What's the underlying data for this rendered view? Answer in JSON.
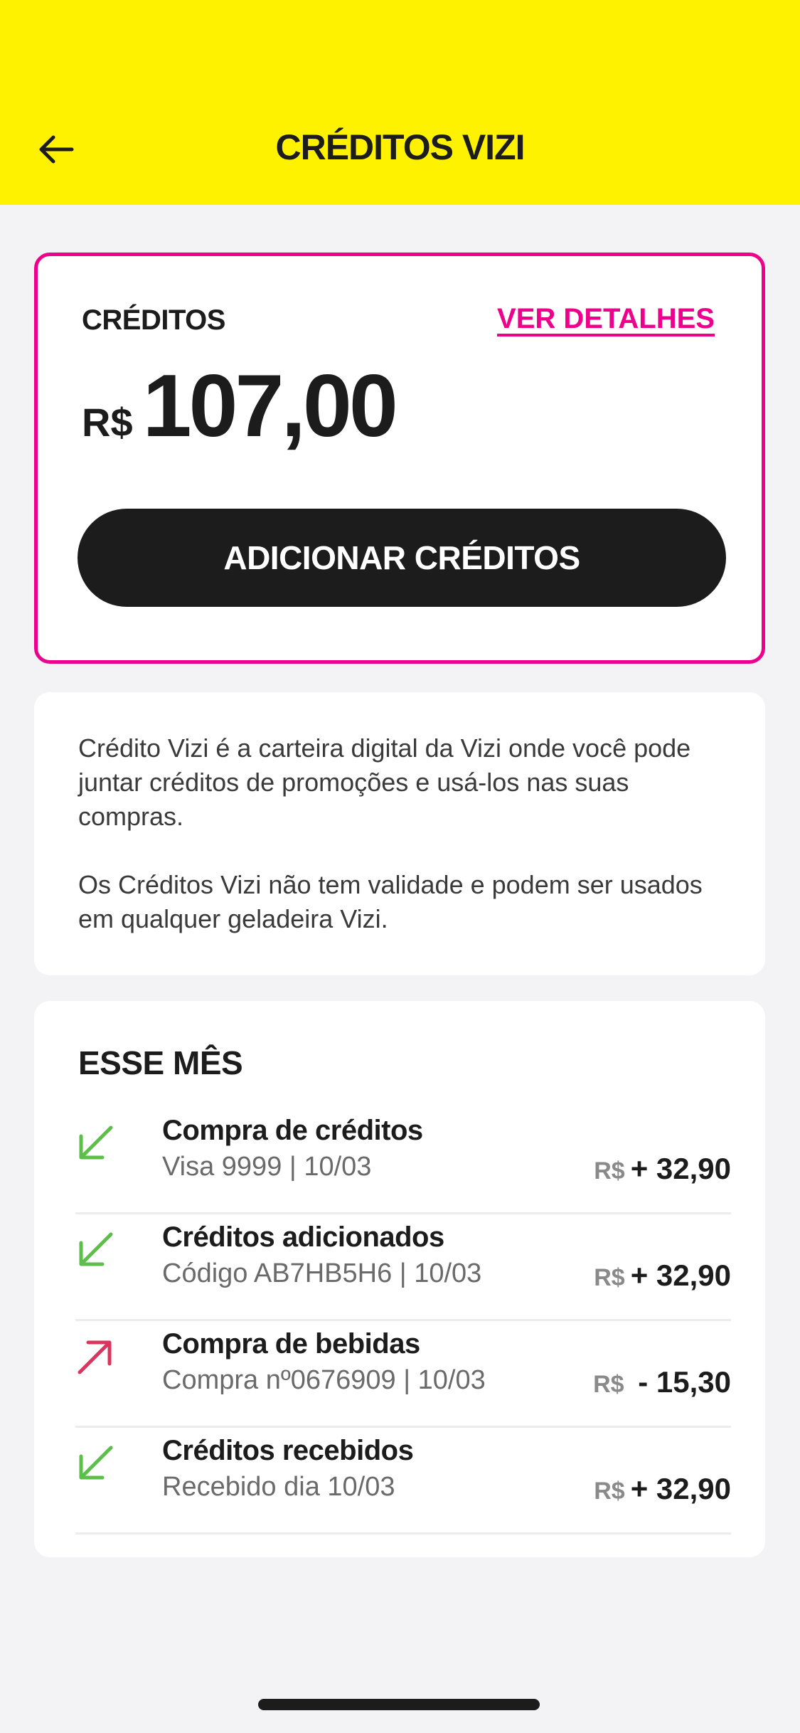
{
  "header": {
    "title": "CRÉDITOS VIZI",
    "back_icon": "arrow-left-icon"
  },
  "balance": {
    "label": "CRÉDITOS",
    "details_link": "VER DETALHES",
    "currency": "R$",
    "amount": "107,00",
    "add_button": "ADICIONAR CRÉDITOS"
  },
  "info": {
    "paragraph1": "Crédito Vizi é a carteira digital da Vizi onde você pode juntar créditos de promoções e usá-los nas suas compras.",
    "paragraph2": "Os Créditos Vizi não tem validade e podem ser usados em qualquer geladeira Vizi."
  },
  "transactions": {
    "title": "ESSE MÊS",
    "items": [
      {
        "name": "Compra de créditos",
        "detail": "Visa 9999 | 10/03",
        "currency": "R$",
        "value": "+ 32,90",
        "direction": "in",
        "icon": "arrow-down-left-icon",
        "color": "#5bbf4a"
      },
      {
        "name": "Créditos adicionados",
        "detail": "Código AB7HB5H6 | 10/03",
        "currency": "R$",
        "value": "+ 32,90",
        "direction": "in",
        "icon": "arrow-down-left-icon",
        "color": "#5bbf4a"
      },
      {
        "name": "Compra de bebidas",
        "detail": "Compra nº0676909 | 10/03",
        "currency": "R$",
        "value": " - 15,30",
        "direction": "out",
        "icon": "arrow-up-right-icon",
        "color": "#d9365e"
      },
      {
        "name": "Créditos recebidos",
        "detail": "Recebido dia 10/03",
        "currency": "R$",
        "value": "+ 32,90",
        "direction": "in",
        "icon": "arrow-down-left-icon",
        "color": "#5bbf4a"
      }
    ]
  },
  "colors": {
    "header_bg": "#fff200",
    "accent": "#ec008c",
    "button_bg": "#1c1c1c"
  }
}
